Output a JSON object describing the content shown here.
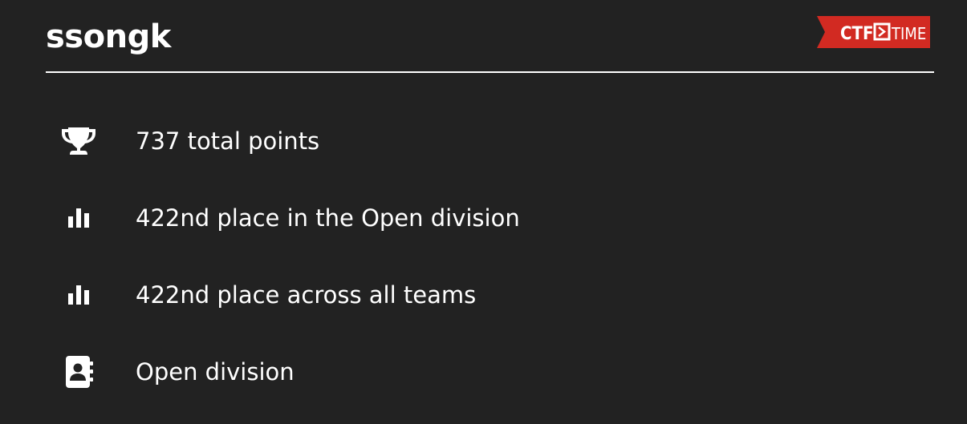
{
  "team": {
    "name": "ssongk"
  },
  "logo": {
    "text_ctf": "CTF",
    "text_time": "TIME",
    "color": "#d22a22"
  },
  "stats": [
    {
      "icon": "trophy-icon",
      "text": "737 total points"
    },
    {
      "icon": "bar-chart-icon",
      "text": "422nd place in the Open division"
    },
    {
      "icon": "bar-chart-icon",
      "text": "422nd place across all teams"
    },
    {
      "icon": "contact-book-icon",
      "text": "Open division"
    }
  ],
  "colors": {
    "background": "#222222",
    "foreground": "#ffffff",
    "accent": "#d22a22"
  }
}
